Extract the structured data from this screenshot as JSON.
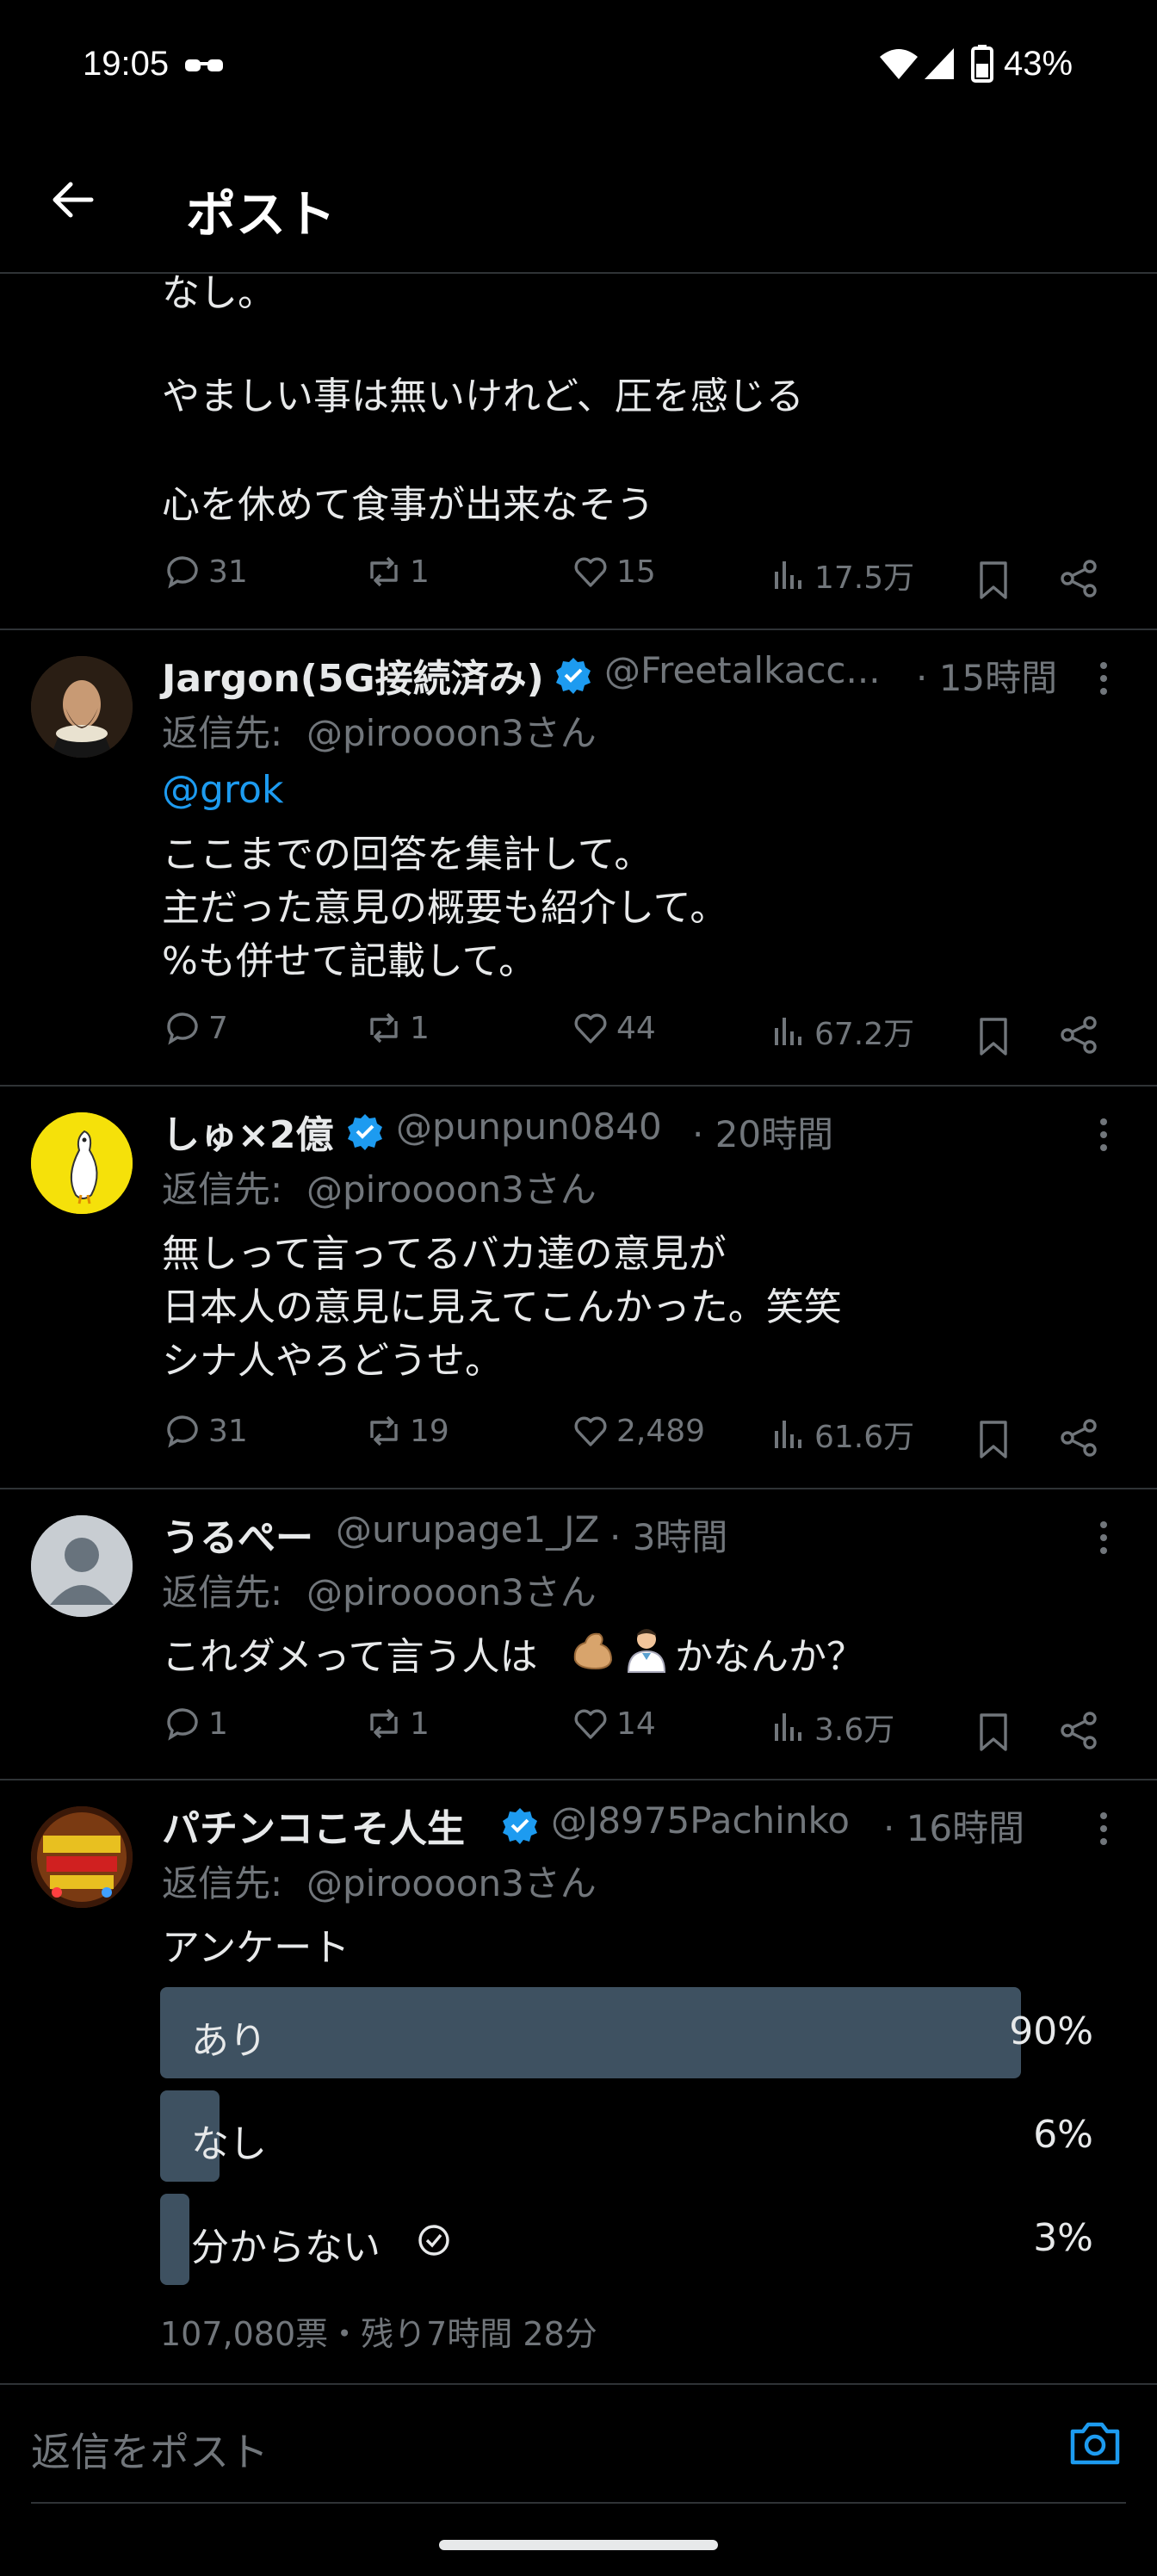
{
  "status_bar": {
    "time": "19:05",
    "battery": "43%"
  },
  "header": {
    "title": "ポスト"
  },
  "top_post": {
    "lines": [
      "なし。",
      "やましい事は無いけれど、圧を感じる",
      "心を休めて食事が出来なそう"
    ],
    "stats": {
      "replies": "31",
      "reposts": "1",
      "likes": "15",
      "views": "17.5万"
    }
  },
  "replies": [
    {
      "name": "Jargon(5G接続済み)",
      "handle": "@Freetalkacc...",
      "time": "· 15時間",
      "reply_to_prefix": "返信先: ",
      "reply_to": "@piroooon3さん",
      "mention": "@grok",
      "lines": [
        "ここまでの回答を集計して。",
        "主だった意見の概要も紹介して。",
        "%も併せて記載して。"
      ],
      "stats": {
        "replies": "7",
        "reposts": "1",
        "likes": "44",
        "views": "67.2万"
      }
    },
    {
      "name": "しゅ×2億",
      "handle": "@punpun0840",
      "time": "· 20時間",
      "reply_to_prefix": "返信先: ",
      "reply_to": "@piroooon3さん",
      "lines": [
        "無しって言ってるバカ達の意見が",
        "日本人の意見に見えてこんかった。笑笑",
        "シナ人やろどうせ。"
      ],
      "stats": {
        "replies": "31",
        "reposts": "19",
        "likes": "2,489",
        "views": "61.6万"
      }
    },
    {
      "name": "うるぺー",
      "handle": "@urupage1_JZ",
      "time": "· 3時間",
      "reply_to_prefix": "返信先: ",
      "reply_to": "@piroooon3さん",
      "line_a": "これダメって言う人は",
      "line_b": "かなんか？",
      "stats": {
        "replies": "1",
        "reposts": "1",
        "likes": "14",
        "views": "3.6万"
      }
    },
    {
      "name": "パチンコこそ人生",
      "handle": "@J8975Pachinko",
      "time": "· 16時間",
      "reply_to_prefix": "返信先: ",
      "reply_to": "@piroooon3さん",
      "text": "アンケート",
      "poll": {
        "options": [
          {
            "label": "あり",
            "percent": "90%",
            "fraction": 0.9
          },
          {
            "label": "なし",
            "percent": "6%",
            "fraction": 0.06
          },
          {
            "label": "分からない",
            "percent": "3%",
            "fraction": 0.03
          }
        ],
        "footer": "107,080票・残り7時間 28分"
      }
    }
  ],
  "reply_input": {
    "placeholder": "返信をポスト"
  },
  "colors": {
    "accent": "#1d9bf0",
    "background": "#000000",
    "poll_bar": "#3e5161",
    "muted": "#71767b"
  }
}
